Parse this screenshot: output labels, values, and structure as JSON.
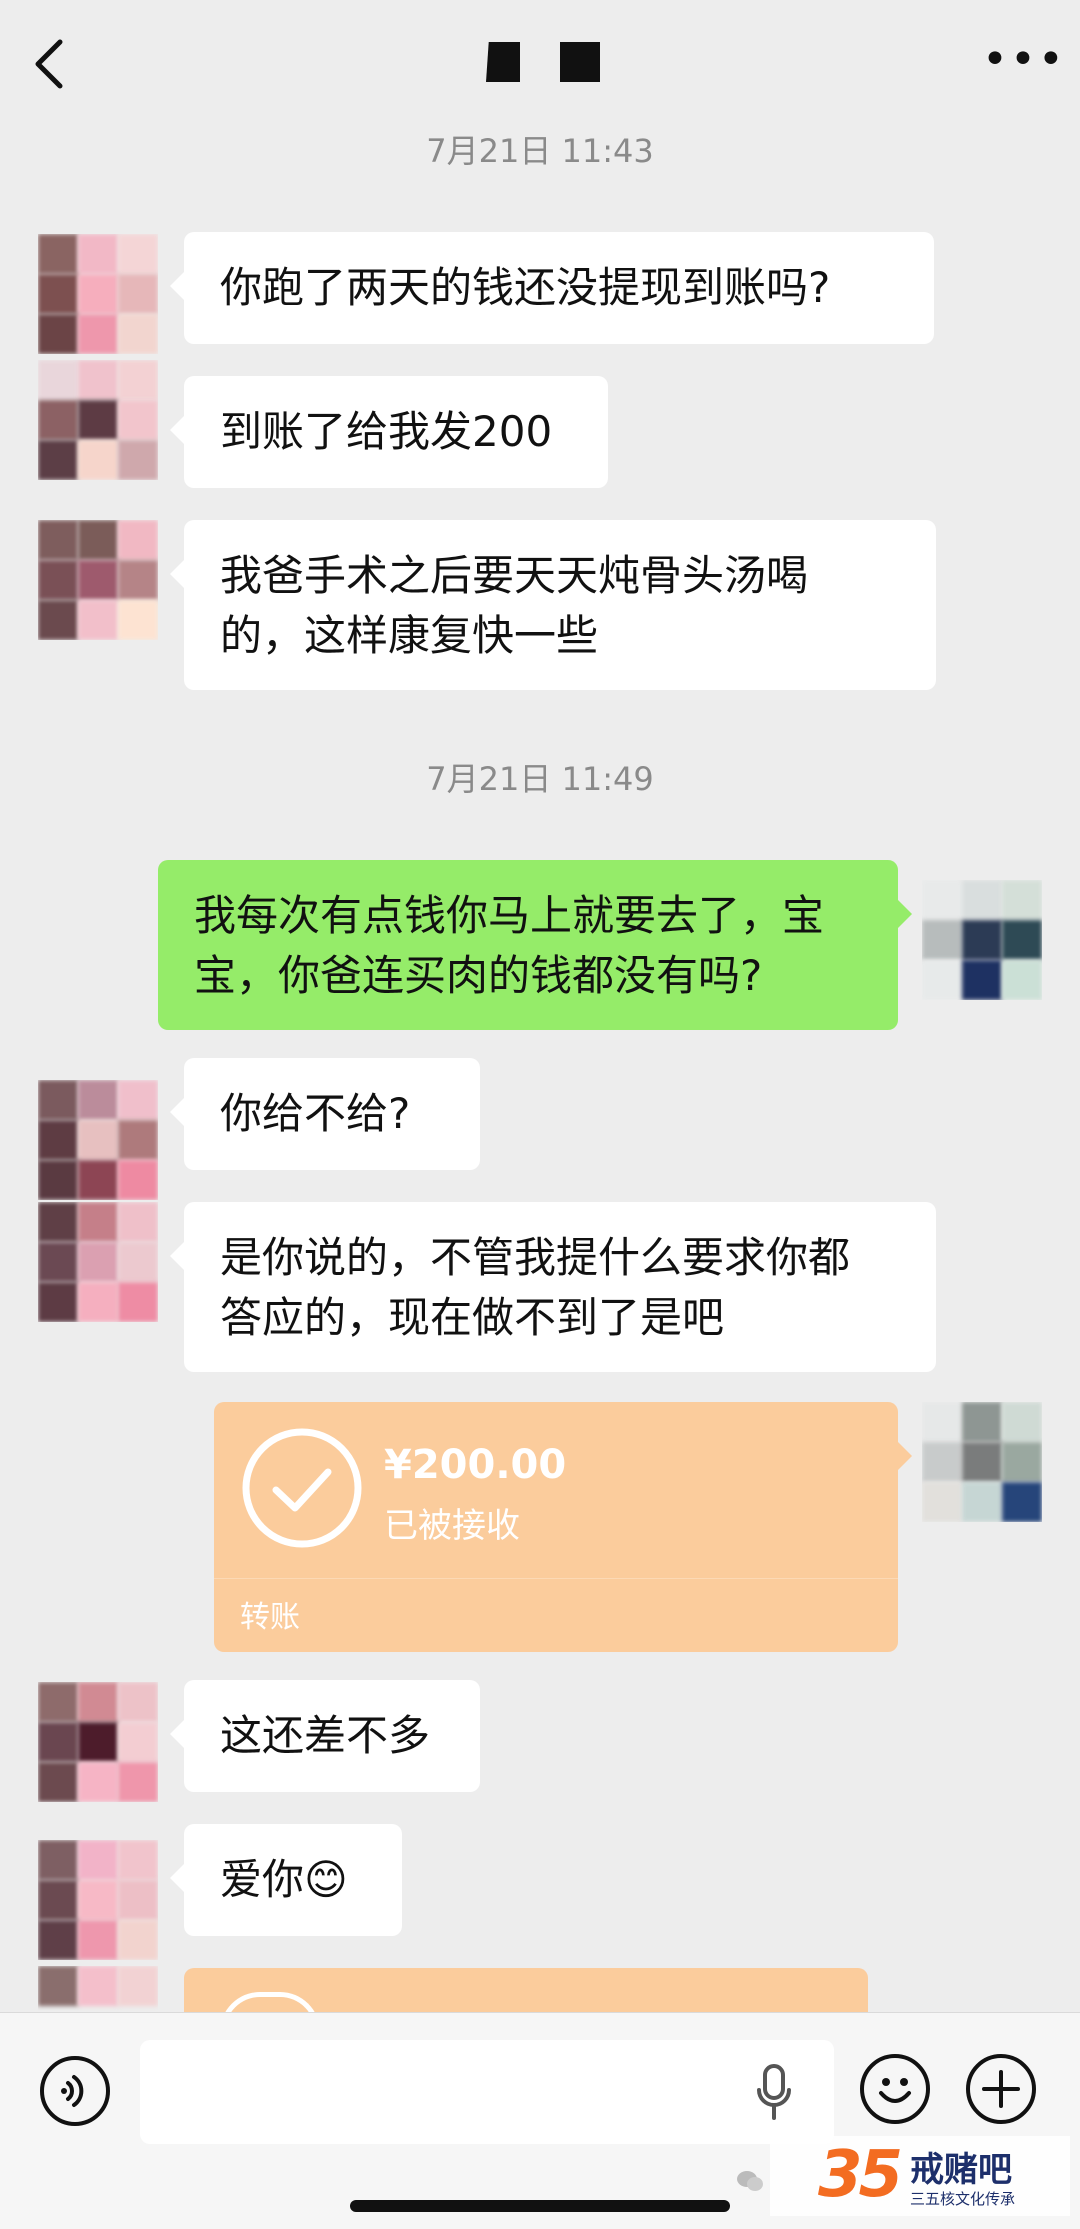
{
  "header": {
    "title_redacted": true
  },
  "messages": {
    "ts1": "7月21日 11:43",
    "m1": "你跑了两天的钱还没提现到账吗?",
    "m2": "到账了给我发200",
    "m3_l1": "我爸手术之后要天天炖骨头汤喝",
    "m3_l2": "的，这样康复快一些",
    "ts2": "7月21日 11:49",
    "m4_l1": "我每次有点钱你马上就要去了，宝",
    "m4_l2": "宝，你爸连买肉的钱都没有吗?",
    "m5": "你给不给?",
    "m6_l1": "是你说的，不管我提什么要求你都",
    "m6_l2": "答应的，现在做不到了是吧",
    "transfer": {
      "amount": "¥200.00",
      "status": "已被接收",
      "label": "转账"
    },
    "m7": "这还差不多",
    "m8": "爱你😊"
  },
  "watermark": {
    "number": "35",
    "brand": "戒赌吧",
    "sub": "三五核文化传承"
  },
  "colors": {
    "background": "#ededed",
    "sent_bubble": "#95ec69",
    "received_bubble": "#ffffff",
    "transfer_card": "#fbcc9c"
  },
  "icons": [
    "back-icon",
    "more-icon",
    "voice-icon",
    "microphone-icon",
    "emoji-icon",
    "plus-icon",
    "check-icon",
    "wechat-icon"
  ]
}
